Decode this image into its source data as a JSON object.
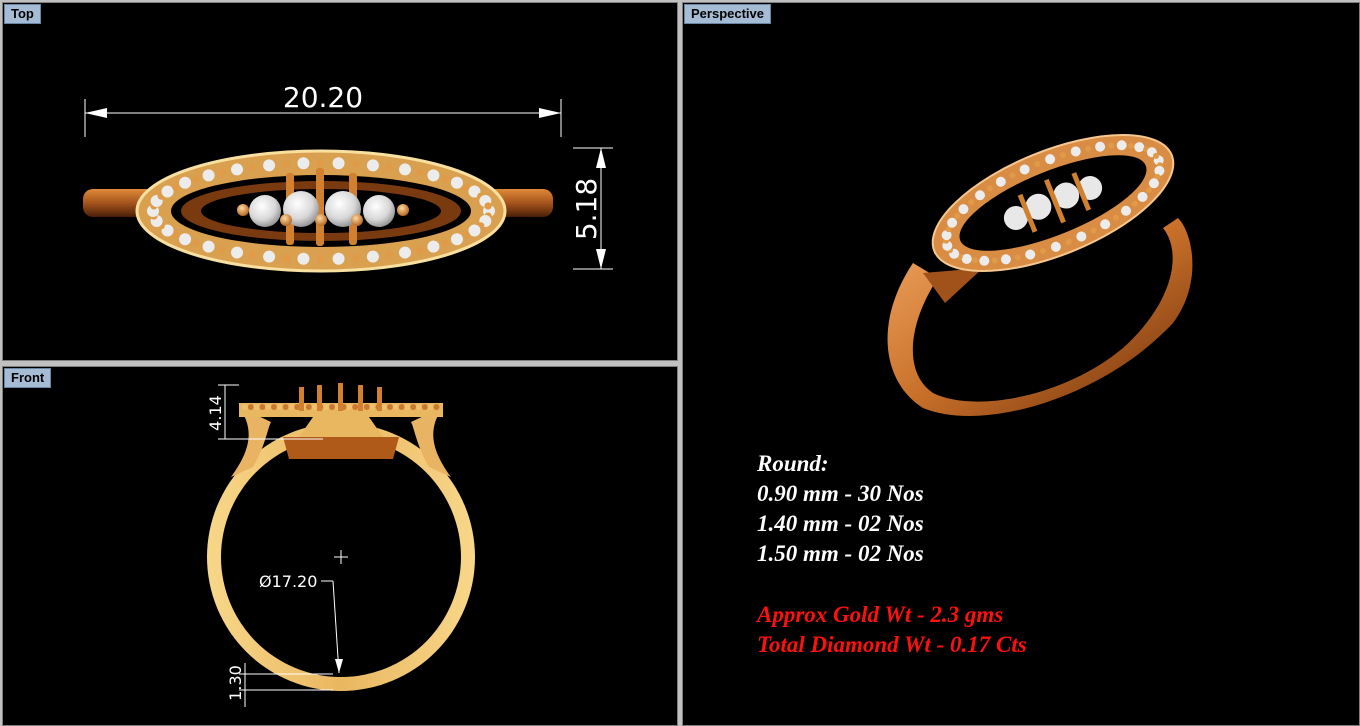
{
  "viewports": {
    "top": {
      "label": "Top"
    },
    "front": {
      "label": "Front"
    },
    "perspective": {
      "label": "Perspective"
    }
  },
  "dimensions": {
    "top_width": "20.20",
    "top_height": "5.18",
    "front_height": "4.14",
    "front_diameter": "Ø17.20",
    "front_thickness": "1.30"
  },
  "specs": {
    "heading": "Round:",
    "lines": [
      "0.90 mm - 30 Nos",
      "1.40 mm - 02 Nos",
      "1.50 mm - 02 Nos"
    ],
    "gold_weight": "Approx Gold Wt - 2.3 gms",
    "diamond_weight": "Total Diamond Wt - 0.17 Cts"
  },
  "colors": {
    "background": "#000000",
    "frame": "#c0c0c0",
    "tab": "#a6bcd4",
    "gold": "#f0c070",
    "rose_gold": "#c8702a",
    "diamond": "#e8e8e8",
    "spec_text": "#ffffff",
    "weight_text": "#ff1010"
  }
}
